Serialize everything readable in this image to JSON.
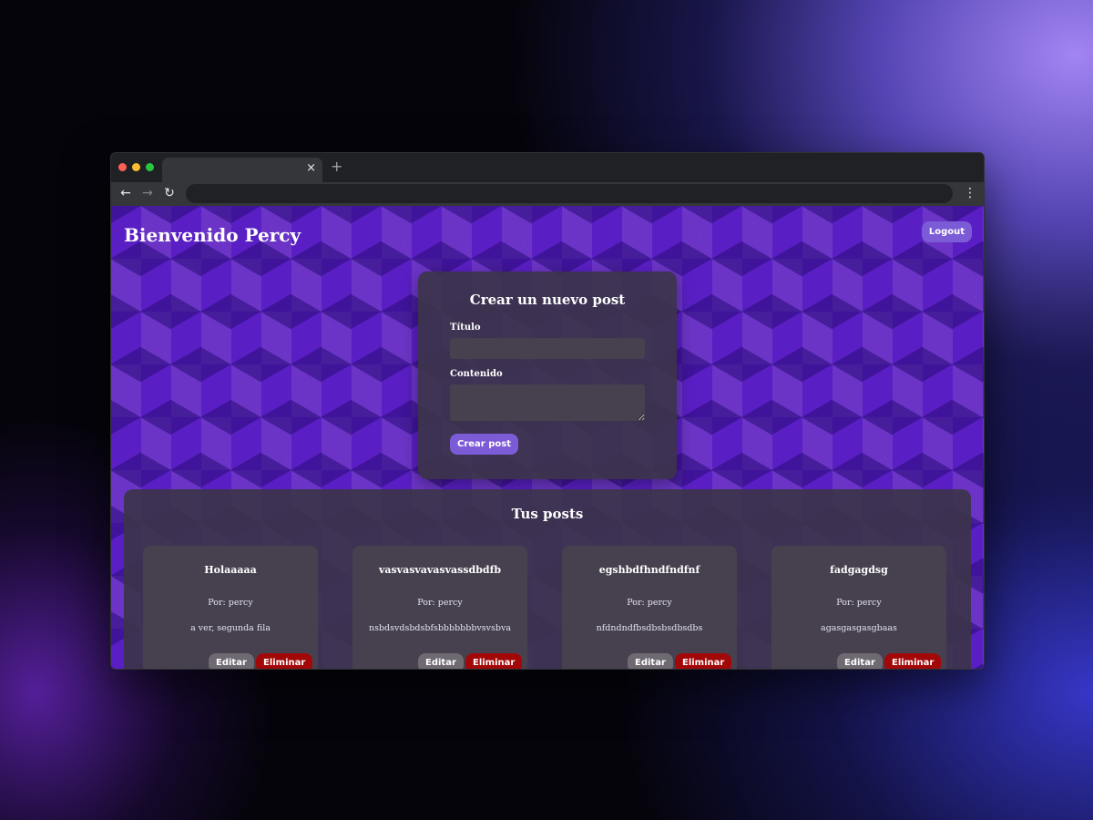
{
  "browser": {
    "tab_close": "×",
    "new_tab": "+",
    "back": "←",
    "forward": "→",
    "reload": "↻",
    "menu": "⋮"
  },
  "page": {
    "welcome": "Bienvenido Percy",
    "logout_label": "Logout",
    "form": {
      "title": "Crear un nuevo post",
      "titulo_label": "Título",
      "titulo_value": "",
      "contenido_label": "Contenido",
      "contenido_value": "",
      "submit_label": "Crear post"
    },
    "posts": {
      "heading": "Tus posts",
      "edit_label": "Editar",
      "delete_label": "Eliminar",
      "items": [
        {
          "title": "Holaaaaa",
          "author": "Por: percy",
          "body": "a ver, segunda fila"
        },
        {
          "title": "vasvasvavasvassdbdfb",
          "author": "Por: percy",
          "body": "nsbdsvdsbdsbfsbbbbbbbvsvsbva"
        },
        {
          "title": "egshbdfhndfndfnf",
          "author": "Por: percy",
          "body": "nfdndndfbsdbsbsdbsdbs"
        },
        {
          "title": "fadgagdsg",
          "author": "Por: percy",
          "body": "agasgasgasgbaas"
        }
      ]
    }
  },
  "colors": {
    "accent": "#7c5bd6",
    "delete": "#a30808",
    "edit": "#6f6a72",
    "card": "#3c344a"
  }
}
